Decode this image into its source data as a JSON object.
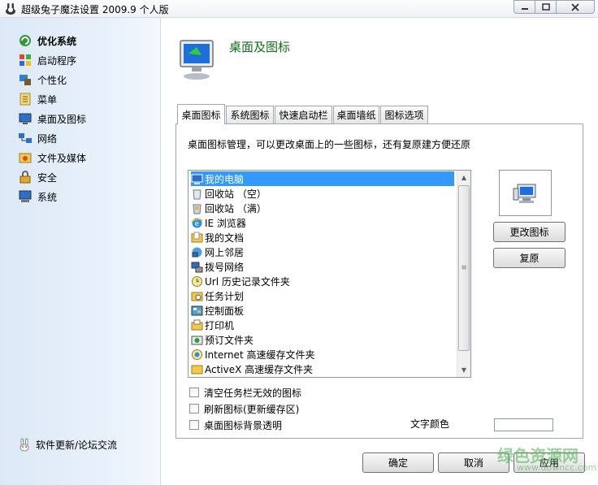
{
  "window": {
    "title": "超级兔子魔法设置 2009.9 个人版"
  },
  "sidebar": {
    "items": [
      {
        "label": "优化系统",
        "icon": "optimize-icon"
      },
      {
        "label": "启动程序",
        "icon": "startup-icon"
      },
      {
        "label": "个性化",
        "icon": "personalize-icon"
      },
      {
        "label": "菜单",
        "icon": "menu-icon"
      },
      {
        "label": "桌面及图标",
        "icon": "desktop-icon"
      },
      {
        "label": "网络",
        "icon": "network-icon"
      },
      {
        "label": "文件及媒体",
        "icon": "media-icon"
      },
      {
        "label": "安全",
        "icon": "lock-icon"
      },
      {
        "label": "系统",
        "icon": "system-icon"
      }
    ],
    "footer": "软件更新/论坛交流"
  },
  "header": {
    "title": "桌面及图标"
  },
  "tabs": [
    {
      "label": "桌面图标",
      "active": true
    },
    {
      "label": "系统图标",
      "active": false
    },
    {
      "label": "快速启动栏",
      "active": false
    },
    {
      "label": "桌面墙纸",
      "active": false
    },
    {
      "label": "图标选项",
      "active": false
    }
  ],
  "panel": {
    "description": "桌面图标管理，可以更改桌面上的一些图标，还有复原建方便还原",
    "list": [
      {
        "label": "我的电脑",
        "icon": "computer-icon",
        "selected": true
      },
      {
        "label": "回收站 （空）",
        "icon": "recycle-bin-empty-icon"
      },
      {
        "label": "回收站 （满）",
        "icon": "recycle-bin-full-icon"
      },
      {
        "label": "IE 浏览器",
        "icon": "ie-icon"
      },
      {
        "label": "我的文档",
        "icon": "documents-folder-icon"
      },
      {
        "label": "网上邻居",
        "icon": "network-places-icon"
      },
      {
        "label": "拨号网络",
        "icon": "dialup-icon"
      },
      {
        "label": "Url 历史记录文件夹",
        "icon": "history-icon"
      },
      {
        "label": "任务计划",
        "icon": "tasks-icon"
      },
      {
        "label": "控制面板",
        "icon": "control-panel-icon"
      },
      {
        "label": "打印机",
        "icon": "printer-folder-icon"
      },
      {
        "label": "预订文件夹",
        "icon": "subscription-icon"
      },
      {
        "label": "Internet 高速缓存文件夹",
        "icon": "cache-icon"
      },
      {
        "label": "ActiveX 高速缓存文件夹",
        "icon": "activex-icon"
      }
    ],
    "change_icon_label": "更改图标",
    "restore_label": "复原",
    "checkboxes": [
      {
        "label": "清空任务栏无效的图标",
        "checked": false
      },
      {
        "label": "刷新图标(更新缓存区)",
        "checked": false
      },
      {
        "label": "桌面图标背景透明",
        "checked": false
      }
    ],
    "text_color_label": "文字颜色",
    "text_color_value": "#ffffff"
  },
  "buttons": {
    "ok": "确定",
    "cancel": "取消",
    "apply": "应用"
  },
  "watermark": {
    "text": "绿色资源网",
    "url": "www.downcc.com"
  },
  "colors": {
    "header_title": "#156b1c",
    "selection": "#3399ff",
    "sidebar_bg": "#dde9f7"
  }
}
